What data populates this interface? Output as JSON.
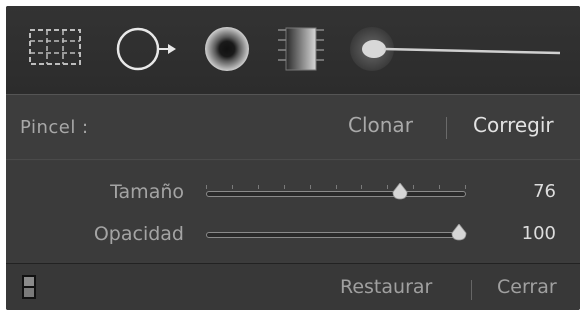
{
  "toolstrip": {
    "tools": [
      {
        "icon": "crop-overlay-icon"
      },
      {
        "icon": "spot-removal-icon"
      },
      {
        "icon": "red-eye-correction-icon"
      },
      {
        "icon": "graduated-filter-icon"
      },
      {
        "icon": "adjustment-brush-icon"
      }
    ],
    "active_tool": "spot-removal-icon"
  },
  "brush": {
    "label": "Pincel :",
    "options": [
      "Clonar",
      "Corregir"
    ],
    "selected": "Corregir"
  },
  "sliders": [
    {
      "label": "Tamaño",
      "value": "76",
      "level": 0.76
    },
    {
      "label": "Opacidad",
      "value": "100",
      "level": 1.0
    }
  ],
  "footer": {
    "reset_label": "Restaurar",
    "close_label": "Cerrar"
  },
  "colors": {
    "panel": "#3c3c3c",
    "toolstrip": "#2e2e2e",
    "text_dim": "#a8a8a8",
    "text_bright": "#e2e2e2"
  }
}
